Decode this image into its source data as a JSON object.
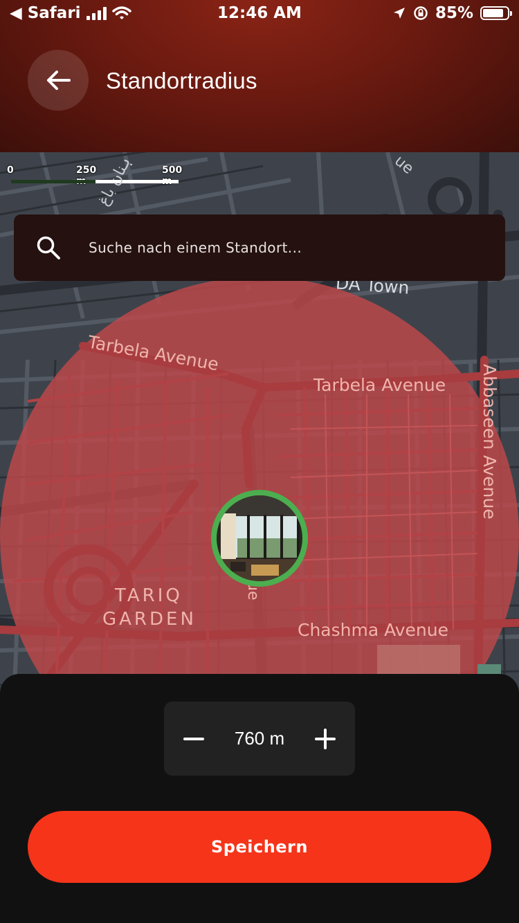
{
  "status_bar": {
    "back_app": "Safari",
    "time": "12:46 AM",
    "battery": "85%",
    "battery_level": 0.85
  },
  "header": {
    "title": "Standortradius"
  },
  "map": {
    "scale": {
      "zero": "0",
      "mid": "250 m",
      "max": "500 m"
    },
    "labels": {
      "tarbela_1": "Tarbela Avenue",
      "tarbela_2": "Tarbela Avenue",
      "abbaseen": "Abbaseen Avenue",
      "chashma": "Chashma Avenue",
      "tariq_1": "TARIQ",
      "tariq_2": "GARDEN",
      "town": "DA Town",
      "arabic": "ہنان باغ",
      "ue_top": "ue",
      "ue_mid": "ue"
    }
  },
  "search": {
    "placeholder": "Suche nach einem Standort..."
  },
  "radius": {
    "value": "760 m"
  },
  "save_button": {
    "label": "Speichern"
  },
  "colors": {
    "accent": "#f5341a",
    "radius_fill": "#c0484b",
    "pin_ring": "#4cae4f"
  }
}
